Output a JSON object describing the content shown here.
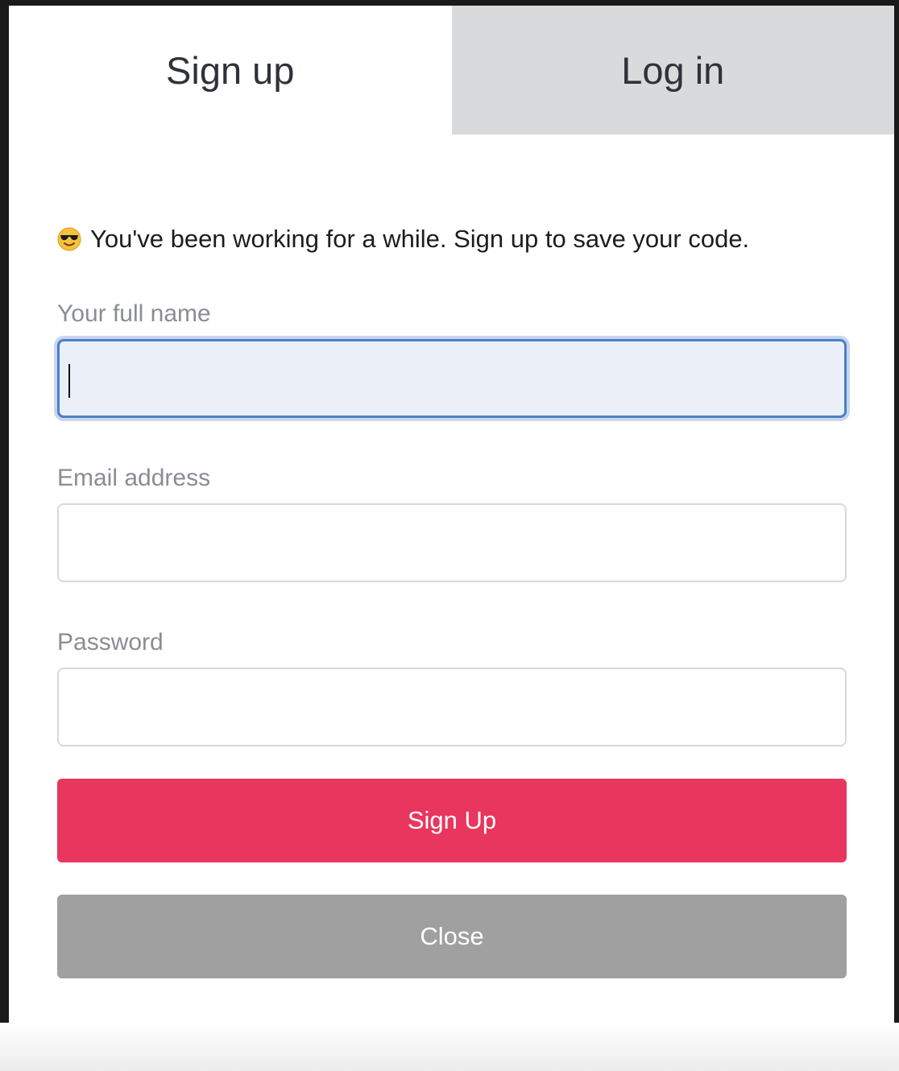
{
  "tabs": {
    "signup": "Sign up",
    "login": "Log in"
  },
  "notice": {
    "emoji_icon": "sunglasses-emoji-icon",
    "text": "You've been working for a while. Sign up to save your code."
  },
  "form": {
    "name_label": "Your full name",
    "name_value": "",
    "email_label": "Email address",
    "email_value": "",
    "password_label": "Password",
    "password_value": ""
  },
  "buttons": {
    "signup": "Sign Up",
    "close": "Close"
  },
  "colors": {
    "primary": "#e9365f",
    "secondary": "#9fa09f",
    "inactive_tab": "#d9dadc",
    "focus_border": "#4d7fc8"
  }
}
